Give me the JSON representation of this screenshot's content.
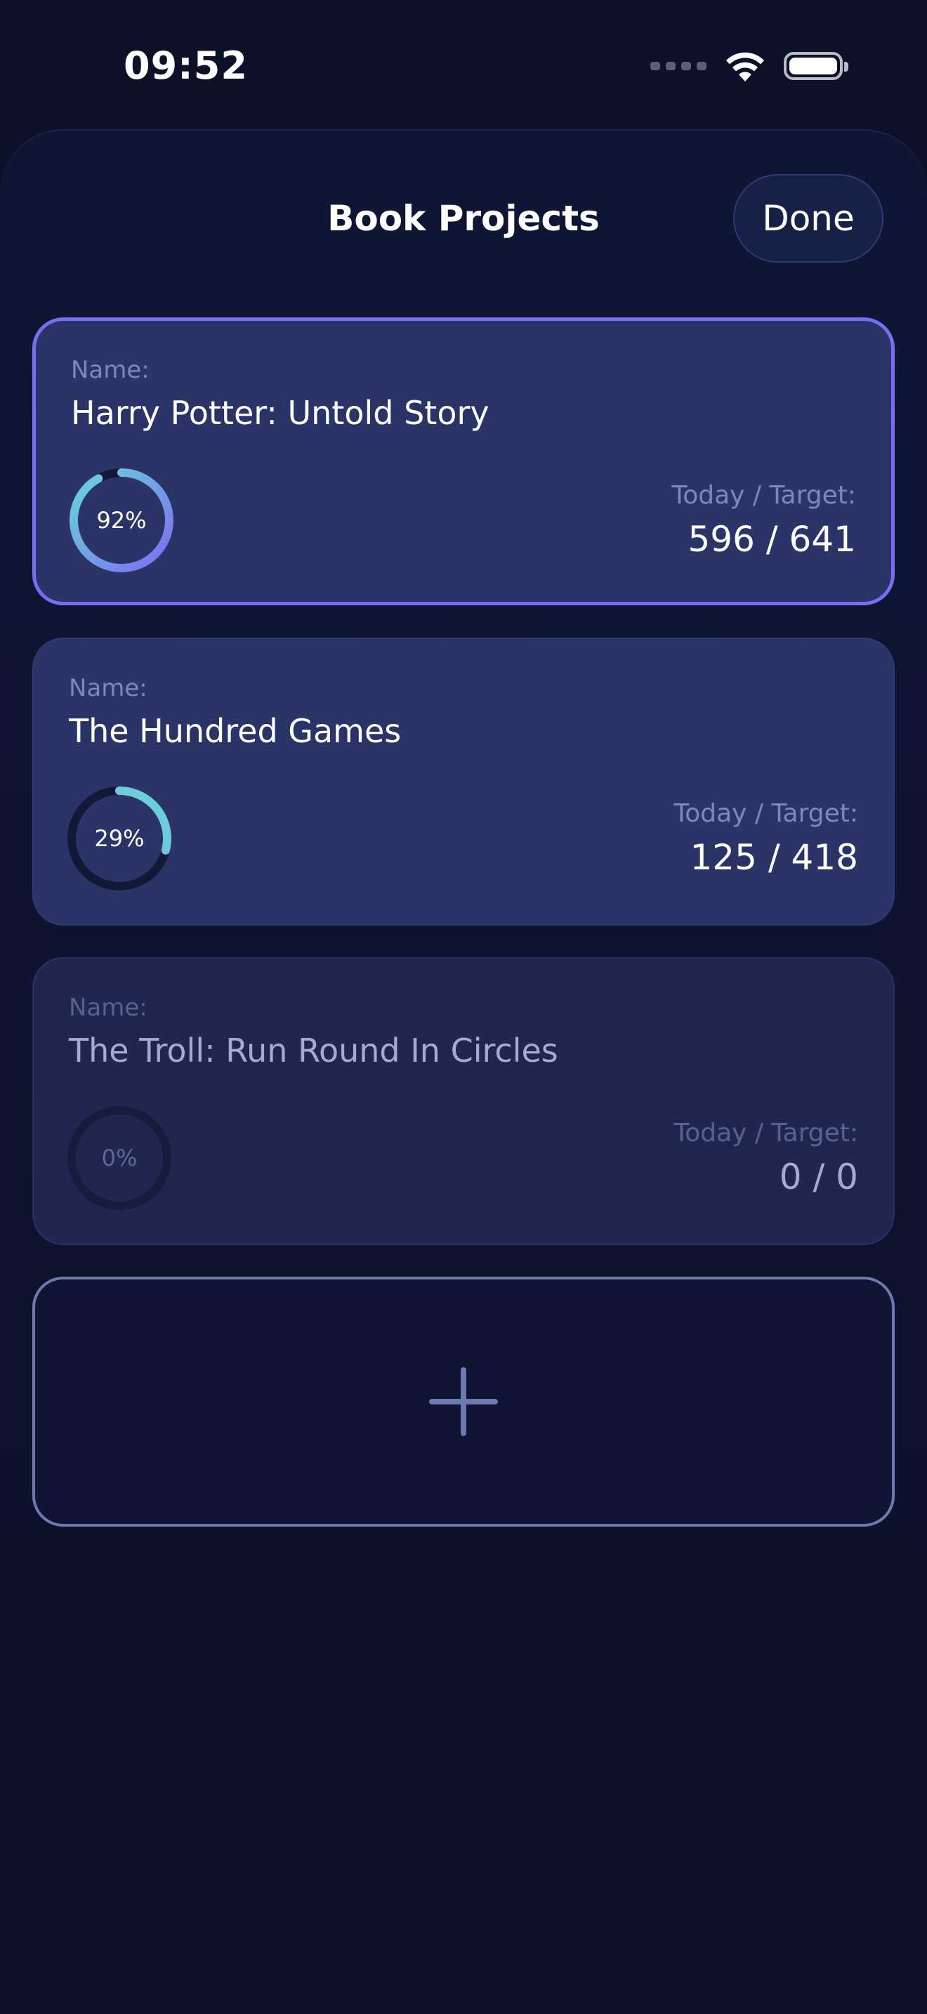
{
  "status_bar": {
    "time": "09:52",
    "icons": [
      "signal-dots-icon",
      "wifi-icon",
      "battery-icon"
    ]
  },
  "header": {
    "title": "Book Projects",
    "done_label": "Done"
  },
  "projects": [
    {
      "name_label": "Name:",
      "name": "Harry Potter: Untold Story",
      "percent_label": "92%",
      "progress": 0.92,
      "target_label": "Today / Target:",
      "target_value": "596 / 641",
      "selected": true
    },
    {
      "name_label": "Name:",
      "name": "The Hundred Games",
      "percent_label": "29%",
      "progress": 0.29,
      "target_label": "Today / Target:",
      "target_value": "125 / 418",
      "selected": false
    },
    {
      "name_label": "Name:",
      "name": "The Troll: Run Round In Circles",
      "percent_label": "0%",
      "progress": 0,
      "target_label": "Today / Target:",
      "target_value": "0 / 0",
      "selected": false
    }
  ],
  "add_button": {
    "icon": "plus-icon"
  },
  "colors": {
    "background": "#0c1128",
    "card": "#2a3466",
    "selected_border": "#7b6cf2",
    "ring_start": "#7b6cf2",
    "ring_end": "#6ad6d8",
    "ring_track": "#121836"
  }
}
